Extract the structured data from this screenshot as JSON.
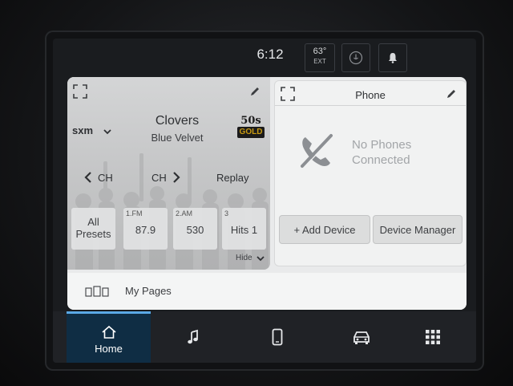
{
  "status": {
    "time": "6:12",
    "temperature": "63°",
    "temperature_label": "EXT"
  },
  "media": {
    "source": "sxm",
    "artist": "Clovers",
    "song": "Blue Velvet",
    "channel_logo_top": "50s",
    "channel_logo_bottom": "GOLD",
    "ch_prev_label": "CH",
    "ch_next_label": "CH",
    "replay_label": "Replay",
    "all_presets_label_1": "All",
    "all_presets_label_2": "Presets",
    "presets": [
      {
        "num": "1.FM",
        "value": "87.9"
      },
      {
        "num": "2.AM",
        "value": "530"
      },
      {
        "num": "3",
        "value": "Hits 1"
      }
    ],
    "hide_label": "Hide"
  },
  "phone": {
    "title": "Phone",
    "status_line1": "No Phones",
    "status_line2": "Connected",
    "add_device_label": "+ Add Device",
    "device_manager_label": "Device Manager"
  },
  "my_pages": {
    "label": "My Pages"
  },
  "nav": {
    "home_label": "Home"
  },
  "colors": {
    "accent": "#5aa9e6",
    "home_bg": "#0f2d44"
  }
}
